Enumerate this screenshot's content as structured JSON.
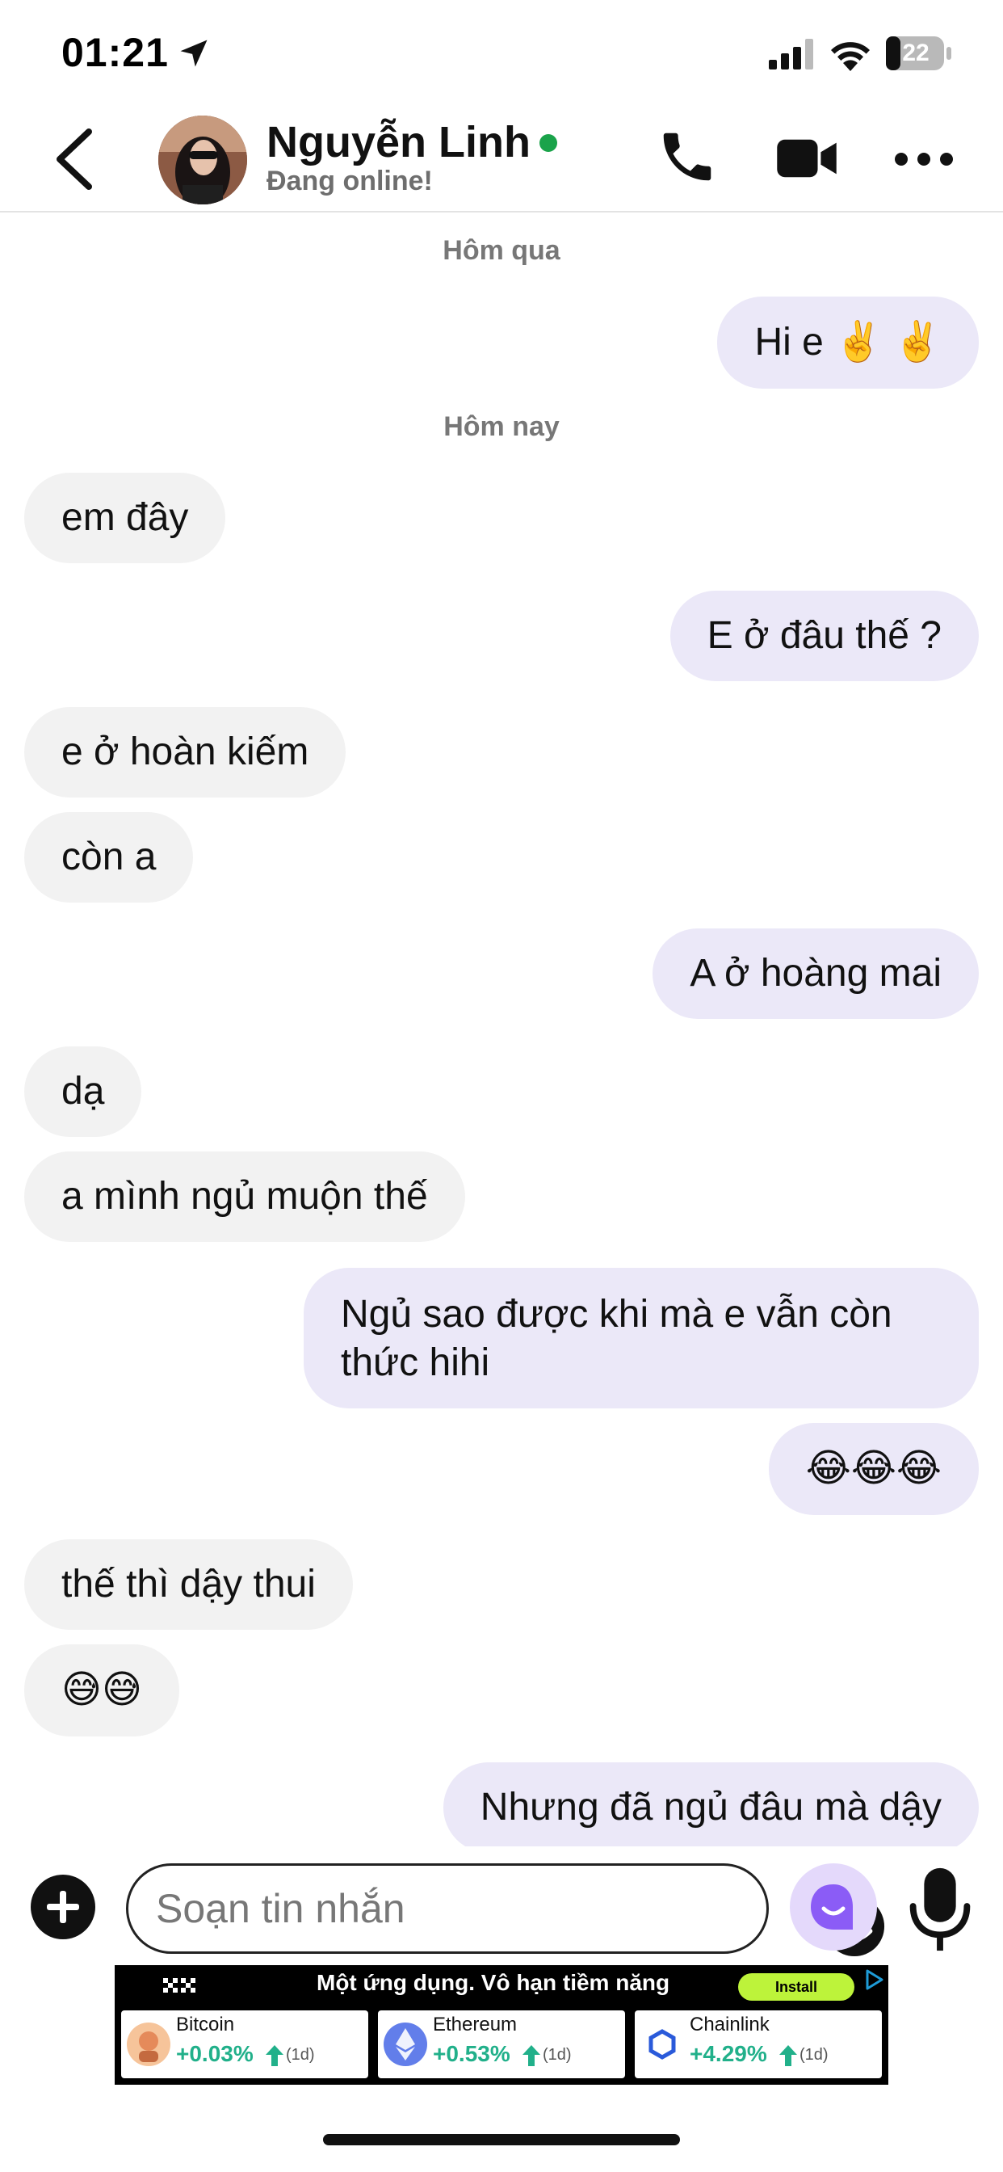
{
  "status_bar": {
    "time": "01:21",
    "battery": "22"
  },
  "header": {
    "name": "Nguyễn Linh",
    "status": "Đang online!"
  },
  "chat": {
    "date_1": "Hôm qua",
    "date_2": "Hôm nay",
    "messages": [
      {
        "from": "me",
        "text": "Hi e ✌️ ✌️"
      },
      {
        "from": "them",
        "text": "em đây"
      },
      {
        "from": "me",
        "text": "E ở đâu thế ?"
      },
      {
        "from": "them",
        "text": "e ở hoàn kiếm"
      },
      {
        "from": "them",
        "text": "còn a"
      },
      {
        "from": "me",
        "text": "A ở hoàng mai"
      },
      {
        "from": "them",
        "text": "dạ"
      },
      {
        "from": "them",
        "text": "a mình ngủ muộn thế"
      },
      {
        "from": "me",
        "text": "Ngủ sao được khi mà e vẫn còn thức hihi"
      },
      {
        "from": "me",
        "text": "😂😂😂"
      },
      {
        "from": "them",
        "text": "thế thì dậy thui"
      },
      {
        "from": "them",
        "text": "😅😅"
      },
      {
        "from": "me",
        "text": "Nhưng đã ngủ đâu mà dậy"
      }
    ]
  },
  "composer": {
    "placeholder": "Soạn tin nhắn"
  },
  "ad": {
    "logo": "OKX",
    "headline": "Một ứng dụng. Vô hạn tiềm năng",
    "install": "Install",
    "coins": [
      {
        "name": "Bitcoin",
        "change": "+0.03%",
        "period": "(1d)"
      },
      {
        "name": "Ethereum",
        "change": "+0.53%",
        "period": "(1d)"
      },
      {
        "name": "Chainlink",
        "change": "+4.29%",
        "period": "(1d)"
      }
    ]
  },
  "colors": {
    "accent": "#8b5cf6",
    "online": "#1aa34a",
    "bubble_in": "#f2f2f2",
    "bubble_out": "#ebe8f8",
    "gain": "#21b08a",
    "install": "#bdf33a"
  }
}
